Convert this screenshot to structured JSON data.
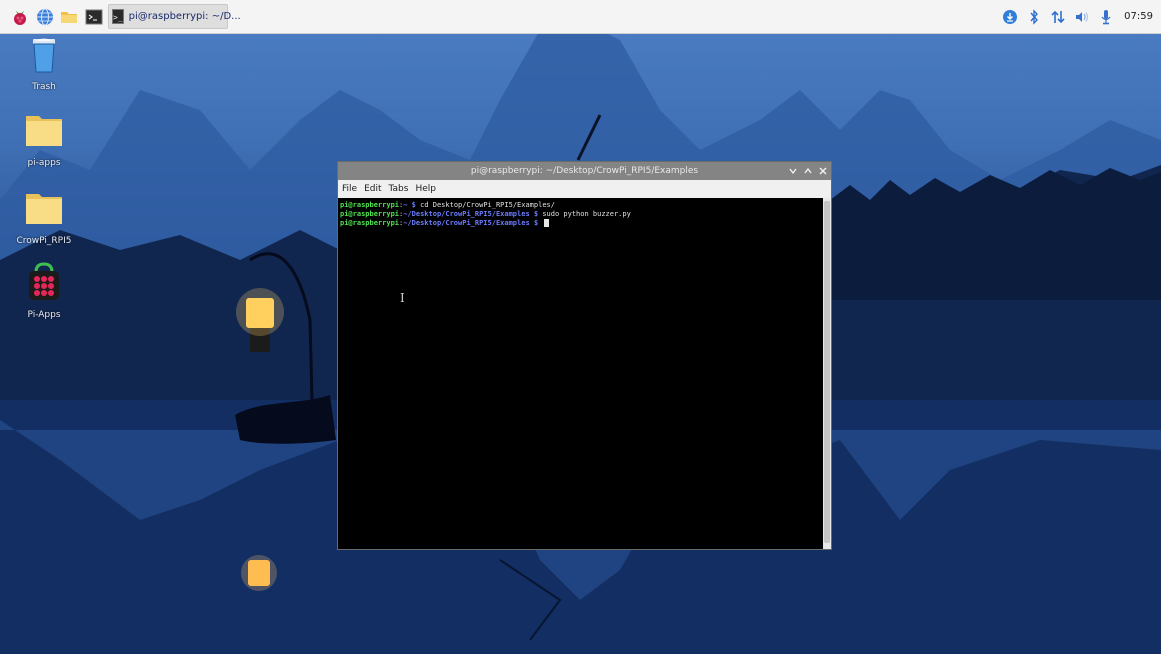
{
  "taskbar": {
    "task_label": "pi@raspberrypi: ~/D...",
    "task_icon_text": ">_",
    "clock": "07:59"
  },
  "desktop": {
    "icons": [
      {
        "label": "Trash"
      },
      {
        "label": "pi-apps"
      },
      {
        "label": "CrowPi_RPI5"
      },
      {
        "label": "Pi-Apps"
      }
    ]
  },
  "terminal": {
    "title": "pi@raspberrypi: ~/Desktop/CrowPi_RPI5/Examples",
    "menu": [
      "File",
      "Edit",
      "Tabs",
      "Help"
    ],
    "lines": [
      {
        "user": "pi@raspberrypi",
        "path": "~",
        "cmd": " cd Desktop/CrowPi_RPI5/Examples/"
      },
      {
        "user": "pi@raspberrypi",
        "path": "~/Desktop/CrowPi_RPI5/Examples",
        "cmd": " sudo python buzzer.py"
      },
      {
        "user": "pi@raspberrypi",
        "path": "~/Desktop/CrowPi_RPI5/Examples",
        "cmd": " "
      }
    ],
    "prompt_symbol": " $",
    "colon": ":",
    "text_cursor": "I"
  },
  "icons": {
    "menu": "raspberry-icon",
    "browser": "globe-icon",
    "files": "folder-icon",
    "terminal": "terminal-icon",
    "tray": [
      "update-icon",
      "bluetooth-icon",
      "network-icon",
      "volume-icon",
      "microphone-icon"
    ]
  },
  "colors": {
    "taskbar": "#f4f4f4",
    "titlebar": "#848484",
    "prompt_user": "#4fe24f",
    "prompt_path": "#6b7cff"
  }
}
